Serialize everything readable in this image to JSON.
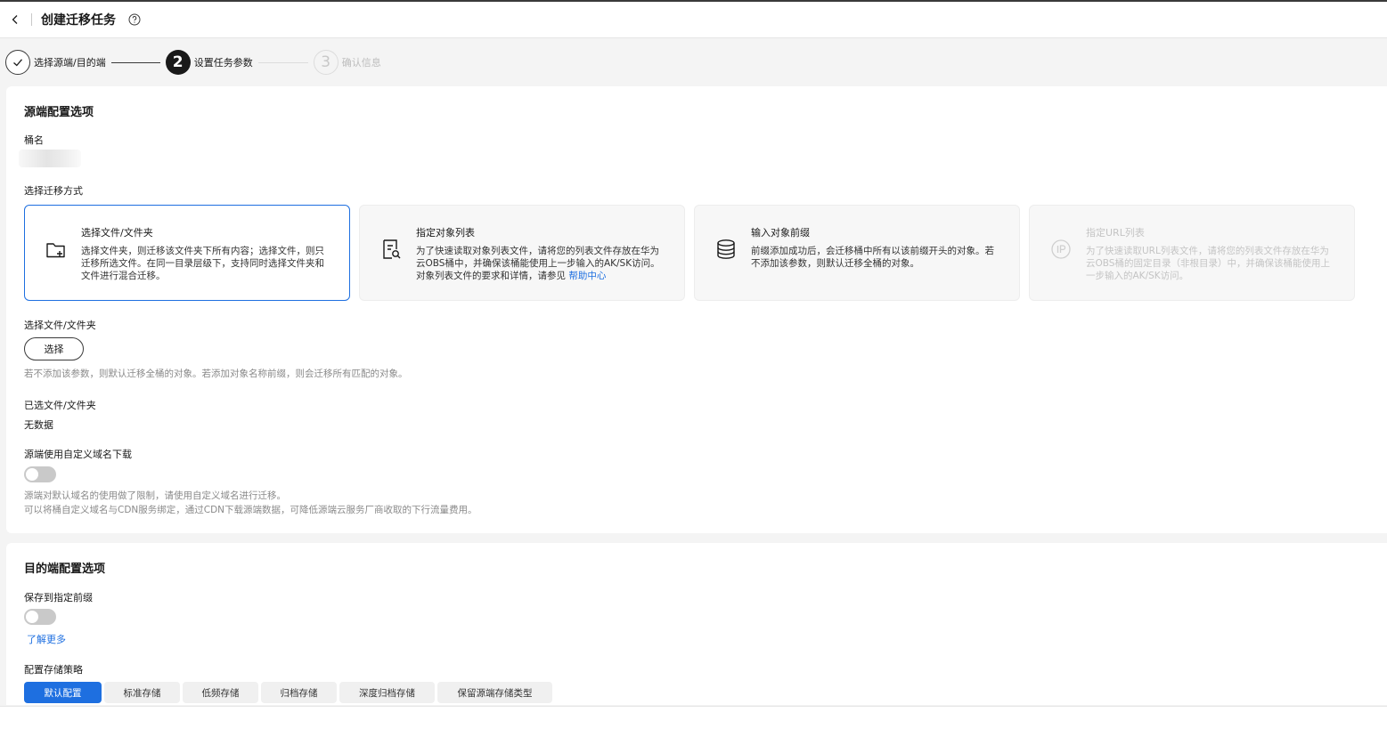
{
  "header": {
    "title": "创建迁移任务"
  },
  "steps": [
    {
      "label": "选择源端/目的端",
      "number": "1",
      "state": "done"
    },
    {
      "label": "设置任务参数",
      "number": "2",
      "state": "current"
    },
    {
      "label": "确认信息",
      "number": "3",
      "state": "todo"
    }
  ],
  "source": {
    "section_title": "源端配置选项",
    "bucket_label": "桶名",
    "mode_label": "选择迁移方式",
    "modes": [
      {
        "title": "选择文件/文件夹",
        "desc": "选择文件夹，则迁移该文件夹下所有内容；选择文件，则只迁移所选文件。在同一目录层级下，支持同时选择文件夹和文件进行混合迁移。",
        "icon": "folder-add-icon",
        "state": "selected"
      },
      {
        "title": "指定对象列表",
        "desc": "为了快速读取对象列表文件，请将您的列表文件存放在华为云OBS桶中，并确保该桶能使用上一步输入的AK/SK访问。对象列表文件的要求和详情，请参见",
        "link": "帮助中心",
        "icon": "file-search-icon",
        "state": "normal"
      },
      {
        "title": "输入对象前缀",
        "desc": "前缀添加成功后，会迁移桶中所有以该前缀开头的对象。若不添加该参数，则默认迁移全桶的对象。",
        "icon": "database-icon",
        "state": "normal"
      },
      {
        "title": "指定URL列表",
        "desc": "为了快速读取URL列表文件，请将您的列表文件存放在华为云OBS桶的固定目录（非根目录）中，并确保该桶能使用上一步输入的AK/SK访问。",
        "icon": "ip-icon",
        "state": "disabled"
      }
    ],
    "file_select_label": "选择文件/文件夹",
    "select_button": "选择",
    "select_hint": "若不添加该参数，则默认迁移全桶的对象。若添加对象名称前缀，则会迁移所有匹配的对象。",
    "selected_label": "已选文件/文件夹",
    "selected_value": "无数据",
    "custom_domain_label": "源端使用自定义域名下载",
    "custom_domain_enabled": false,
    "custom_domain_hint1": "源端对默认域名的使用做了限制，请使用自定义域名进行迁移。",
    "custom_domain_hint2": "可以将桶自定义域名与CDN服务绑定，通过CDN下载源端数据，可降低源端云服务厂商收取的下行流量费用。"
  },
  "destination": {
    "section_title": "目的端配置选项",
    "prefix_label": "保存到指定前缀",
    "prefix_enabled": false,
    "learn_more": "了解更多",
    "storage_label": "配置存储策略",
    "storage_tabs": [
      "默认配置",
      "标准存储",
      "低频存储",
      "归档存储",
      "深度归档存储",
      "保留源端存储类型"
    ],
    "storage_selected": "默认配置"
  },
  "colors": {
    "accent": "#1e6fe0",
    "dark": "#191919"
  }
}
